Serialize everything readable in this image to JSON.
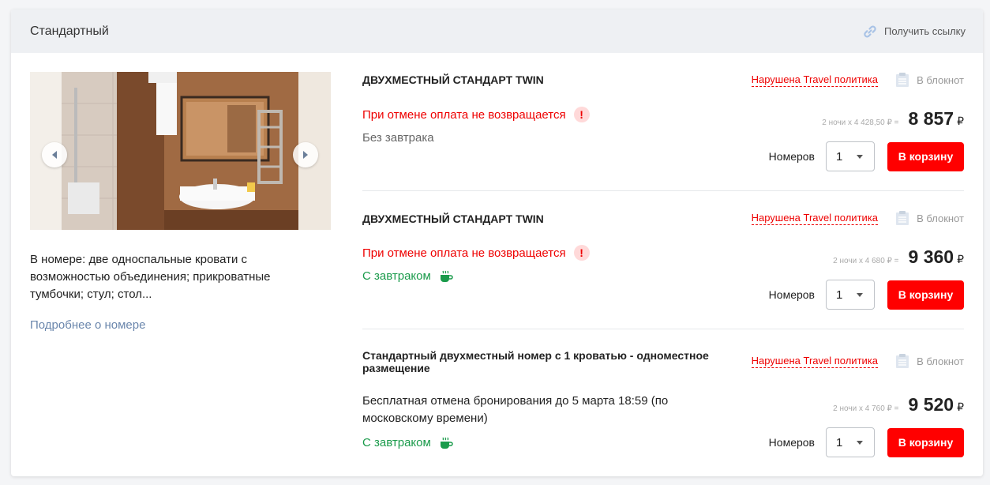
{
  "card": {
    "title": "Стандартный",
    "get_link_label": "Получить ссылку"
  },
  "room": {
    "description": "В номере: две односпальные кровати с возможностью объединения; прикроватные тумбочки; стул; стол...",
    "more_link": "Подробнее о номере"
  },
  "offers": [
    {
      "name": "ДВУХМЕСТНЫЙ СТАНДАРТ TWIN",
      "policy": "Нарушена Travel политика",
      "notebook": "В блокнот",
      "cancellation": "При отмене оплата не возвращается",
      "meal": "Без завтрака",
      "calc": "2 ночи х 4 428,50 ₽ =",
      "price": "8 857",
      "currency": "₽",
      "rooms_label": "Номеров",
      "rooms_value": "1",
      "buy": "В корзину"
    },
    {
      "name": "ДВУХМЕСТНЫЙ СТАНДАРТ TWIN",
      "policy": "Нарушена Travel политика",
      "notebook": "В блокнот",
      "cancellation": "При отмене оплата не возвращается",
      "meal": "С завтраком",
      "calc": "2 ночи х 4 680 ₽ =",
      "price": "9 360",
      "currency": "₽",
      "rooms_label": "Номеров",
      "rooms_value": "1",
      "buy": "В корзину"
    },
    {
      "name": "Стандартный двухместный номер с 1 кроватью - одноместное размещение",
      "policy": "Нарушена Travel политика",
      "notebook": "В блокнот",
      "cancellation": "Бесплатная отмена бронирования до 5 марта 18:59 (по московскому времени)",
      "meal": "С завтраком",
      "calc": "2 ночи х 4 760 ₽ =",
      "price": "9 520",
      "currency": "₽",
      "rooms_label": "Номеров",
      "rooms_value": "1",
      "buy": "В корзину"
    }
  ],
  "colors": {
    "accent_red": "#ff0000",
    "green": "#1a9b4b",
    "link_blue": "#6a86ac"
  }
}
